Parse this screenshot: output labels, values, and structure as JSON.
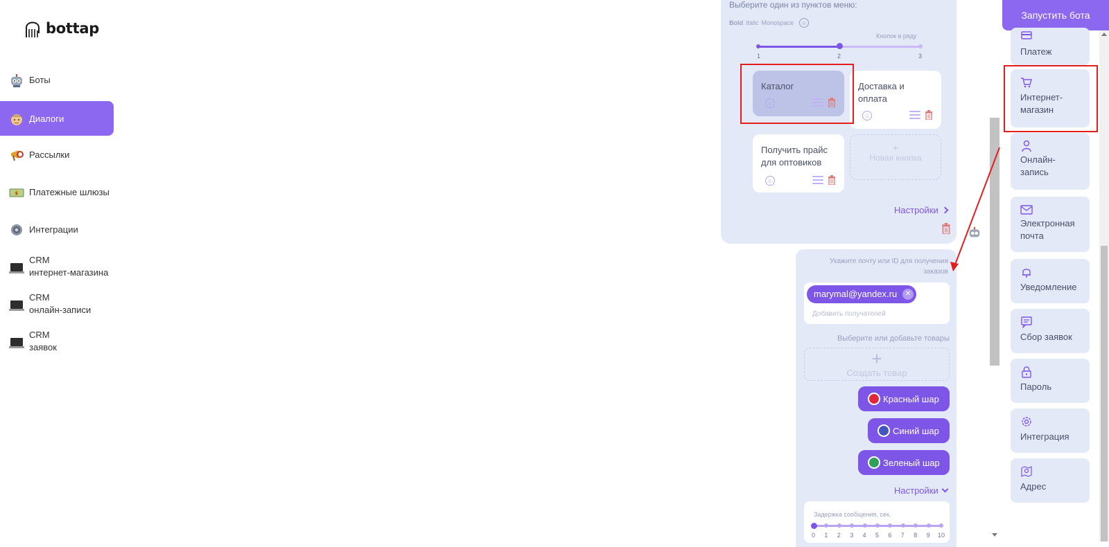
{
  "brand": {
    "logo_text": "bottap"
  },
  "sidebar": {
    "items": [
      {
        "label": "Боты",
        "icon": "robot-icon"
      },
      {
        "label": "Диалоги",
        "icon": "face-icon",
        "active": true
      },
      {
        "label": "Рассылки",
        "icon": "horn-icon"
      },
      {
        "label": "Платежные шлюзы",
        "icon": "money-icon"
      },
      {
        "label": "Интеграции",
        "icon": "gear-icon"
      },
      {
        "label_line1": "CRM",
        "label_line2": "интернет-магазина",
        "icon": "laptop-icon"
      },
      {
        "label_line1": "CRM",
        "label_line2": "онлайн-записи",
        "icon": "laptop-icon"
      },
      {
        "label_line1": "CRM",
        "label_line2": "заявок",
        "icon": "laptop-icon"
      }
    ]
  },
  "menu_block": {
    "hint": "Выберите один из пунктов меню:",
    "format": {
      "bold": "Bold",
      "italic": "Italic",
      "mono": "Monospace"
    },
    "buttons_per_row_label": "Кнопок в ряду",
    "buttons_per_row": {
      "min": 1,
      "value": 2,
      "max": 3,
      "ticks": [
        "1",
        "2",
        "3"
      ]
    },
    "buttons": [
      {
        "line1": "Каталог",
        "line2": ""
      },
      {
        "line1": "Доставка и",
        "line2": "оплата"
      },
      {
        "line1": "Получить прайс",
        "line2": "для оптовиков"
      }
    ],
    "new_button": {
      "plus": "+",
      "label": "Новая кнопка"
    },
    "settings_label": "Настройки"
  },
  "shop_block": {
    "recipient_label_line1": "Укажите почту или ID для получения",
    "recipient_label_line2": "заказов",
    "recipient_email": "marymal@yandex.ru",
    "add_recipient_placeholder": "Добавить получателей",
    "products_label": "Выберите или добавьте товары",
    "create_product": "Создать товар",
    "products": [
      {
        "label": "Красный шар",
        "color": "#e0283a"
      },
      {
        "label": "Синий шар",
        "color": "#4455bb"
      },
      {
        "label": "Зеленый шар",
        "color": "#2fa05a"
      }
    ],
    "settings_label": "Настройки",
    "delay_label": "Задержка сообщения, сек.",
    "delay_ticks": [
      "0",
      "1",
      "2",
      "3",
      "4",
      "5",
      "6",
      "7",
      "8",
      "9",
      "10"
    ],
    "delay_value": 0
  },
  "right_panel": {
    "launch_label": "Запустить бота",
    "items": [
      {
        "line1": "Платеж",
        "line2": "",
        "icon": "card-icon"
      },
      {
        "line1": "Интернет-",
        "line2": "магазин",
        "icon": "cart-icon"
      },
      {
        "line1": "Онлайн-",
        "line2": "запись",
        "icon": "person-icon"
      },
      {
        "line1": "Электронная",
        "line2": "почта",
        "icon": "mail-icon"
      },
      {
        "line1": "Уведомление",
        "line2": "",
        "icon": "bell-icon"
      },
      {
        "line1": "Сбор заявок",
        "line2": "",
        "icon": "form-icon"
      },
      {
        "line1": "Пароль",
        "line2": "",
        "icon": "lock-icon"
      },
      {
        "line1": "Интеграция",
        "line2": "",
        "icon": "gear-icon"
      },
      {
        "line1": "Адрес",
        "line2": "",
        "icon": "map-pin-icon"
      }
    ]
  },
  "colors": {
    "accent": "#8c67ef",
    "panel": "#e4e9f8",
    "highlight": "#e51c1c"
  }
}
